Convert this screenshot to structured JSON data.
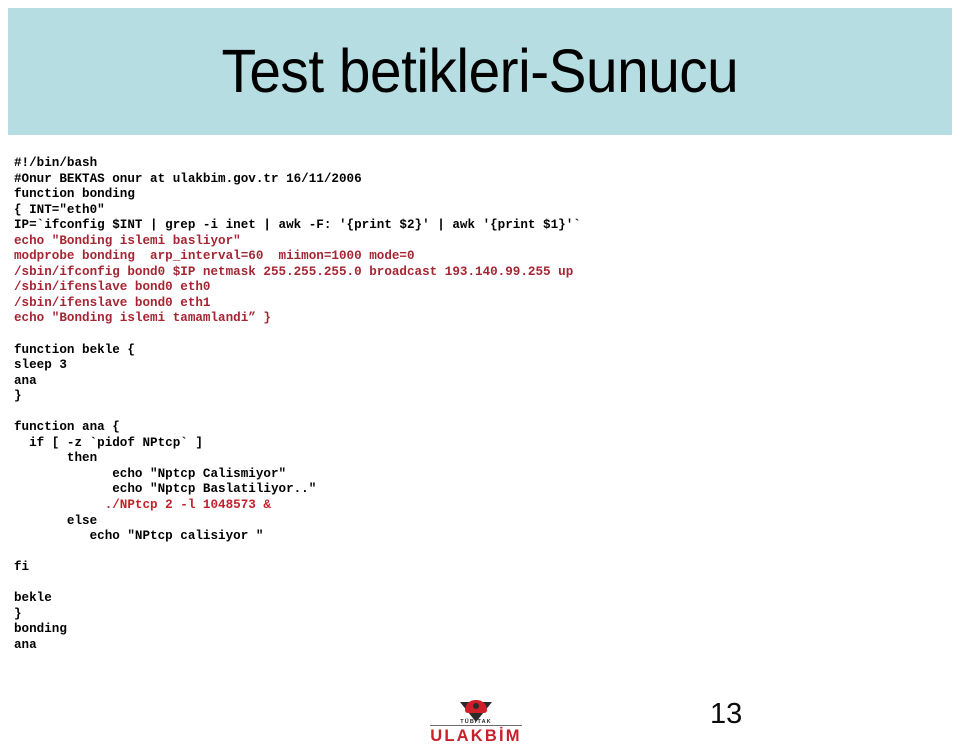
{
  "slide": {
    "title": "Test betikleri-Sunucu",
    "page_number": "13",
    "band_color": "#b6dde1",
    "code_black": "#000000",
    "code_dark_red": "#a42633",
    "code_red": "#c4202b"
  },
  "code": {
    "lines": [
      {
        "text": "#!/bin/bash",
        "color": "black"
      },
      {
        "text": "#Onur BEKTAS onur at ulakbim.gov.tr 16/11/2006",
        "color": "black"
      },
      {
        "text": "function bonding",
        "color": "black"
      },
      {
        "text": "{ INT=\"eth0\"",
        "color": "black"
      },
      {
        "text": "IP=`ifconfig $INT | grep -i inet | awk -F: '{print $2}' | awk '{print $1}'`",
        "color": "black"
      },
      {
        "text": "echo \"Bonding islemi basliyor\"",
        "color": "dkred"
      },
      {
        "text": "modprobe bonding  arp_interval=60  miimon=1000 mode=0",
        "color": "dkred"
      },
      {
        "text": "/sbin/ifconfig bond0 $IP netmask 255.255.255.0 broadcast 193.140.99.255 up",
        "color": "dkred"
      },
      {
        "text": "/sbin/ifenslave bond0 eth0",
        "color": "dkred"
      },
      {
        "text": "/sbin/ifenslave bond0 eth1",
        "color": "dkred"
      },
      {
        "text": "echo \"Bonding islemi tamamlandi” }",
        "color": "dkred"
      },
      {
        "text": "",
        "color": "black"
      },
      {
        "text": "function bekle {",
        "color": "black"
      },
      {
        "text": "sleep 3",
        "color": "black"
      },
      {
        "text": "ana",
        "color": "black"
      },
      {
        "text": "}",
        "color": "black"
      },
      {
        "text": "",
        "color": "black"
      },
      {
        "text": "function ana {",
        "color": "black"
      },
      {
        "text": "  if [ -z `pidof NPtcp` ]",
        "color": "black"
      },
      {
        "text": "       then",
        "color": "black"
      },
      {
        "text": "             echo \"Nptcp Calismiyor\"",
        "color": "black"
      },
      {
        "text": "             echo \"Nptcp Baslatiliyor..\"",
        "color": "black"
      },
      {
        "text": "            ./NPtcp 2 -l 1048573 &",
        "color": "red"
      },
      {
        "text": "       else",
        "color": "black"
      },
      {
        "text": "          echo \"NPtcp calisiyor \"",
        "color": "black"
      },
      {
        "text": "",
        "color": "black"
      },
      {
        "text": "fi",
        "color": "black"
      },
      {
        "text": "",
        "color": "black"
      },
      {
        "text": "bekle",
        "color": "black"
      },
      {
        "text": "}",
        "color": "black"
      },
      {
        "text": "bonding",
        "color": "black"
      },
      {
        "text": "ana",
        "color": "black"
      }
    ]
  },
  "logo": {
    "institute": "TÜBİTAK",
    "name": "ULAKBİM"
  }
}
